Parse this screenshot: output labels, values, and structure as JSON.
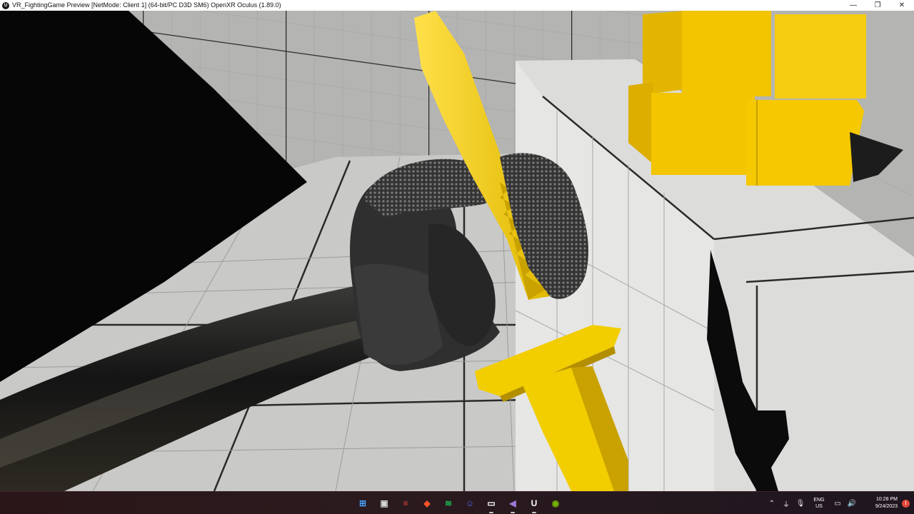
{
  "window": {
    "title": "VR_FightingGame Preview [NetMode: Client 1]  (64-bit/PC D3D SM6) OpenXR Oculus (1.89.0)",
    "app_icon": "U",
    "minimize_glyph": "—",
    "maximize_glyph": "❐",
    "close_glyph": "✕"
  },
  "scene": {
    "colors": {
      "floor": "#c9c9c7",
      "wall": "#b4b4b2",
      "wall_right": "#e3e3e1",
      "grid_major": "#222222",
      "grid_minor": "#a3a3a1",
      "shadow": "#060606",
      "knife": "#f2cd00",
      "knife_dark": "#c9a200",
      "glove": "#2e2e2e",
      "glove_highlight": "#8a8a88",
      "sleeve": "#1a1a1a",
      "cube": "#f3c400"
    }
  },
  "taskbar": {
    "apps": [
      {
        "name": "start-icon",
        "glyph": "⊞",
        "color": "#4aa3ff",
        "active": false
      },
      {
        "name": "file-explorer-icon",
        "glyph": "▣",
        "color": "#d8d8d8",
        "active": false
      },
      {
        "name": "todoist-icon",
        "glyph": "≡",
        "color": "#e44332",
        "active": false
      },
      {
        "name": "brave-icon",
        "glyph": "◆",
        "color": "#fb542b",
        "active": false
      },
      {
        "name": "spotify-icon",
        "glyph": "≋",
        "color": "#1db954",
        "active": false
      },
      {
        "name": "discord-icon",
        "glyph": "☺",
        "color": "#5865f2",
        "active": false
      },
      {
        "name": "vr-headset-icon",
        "glyph": "▭",
        "color": "#ffffff",
        "active": true
      },
      {
        "name": "visual-studio-icon",
        "glyph": "◀",
        "color": "#a179dc",
        "active": true
      },
      {
        "name": "unreal-engine-icon",
        "glyph": "U",
        "color": "#ffffff",
        "active": true
      },
      {
        "name": "nvidia-icon",
        "glyph": "◉",
        "color": "#76b900",
        "active": false
      }
    ],
    "tray": {
      "chevron_glyph": "⌃",
      "usb_glyph": "⏚",
      "mic_glyph": "🎙",
      "lang_line1": "ENG",
      "lang_line2": "US",
      "network_glyph": "▭",
      "volume_glyph": "🔊",
      "time": "10:28 PM",
      "date": "9/24/2023",
      "notification_count": "!"
    }
  }
}
